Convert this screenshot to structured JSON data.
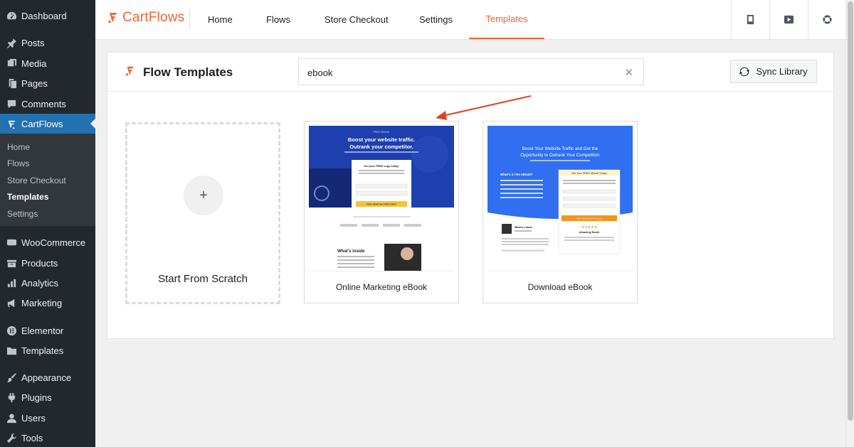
{
  "sidebar": {
    "dashboard": "Dashboard",
    "posts": "Posts",
    "media": "Media",
    "pages": "Pages",
    "comments": "Comments",
    "cartflows": "CartFlows",
    "submenu": [
      "Home",
      "Flows",
      "Store Checkout",
      "Templates",
      "Settings"
    ],
    "woocommerce": "WooCommerce",
    "products": "Products",
    "analytics": "Analytics",
    "marketing": "Marketing",
    "elementor": "Elementor",
    "templates": "Templates",
    "appearance": "Appearance",
    "plugins": "Plugins",
    "users": "Users",
    "tools": "Tools"
  },
  "topbar": {
    "brand": "CartFlows",
    "tabs": [
      "Home",
      "Flows",
      "Store Checkout",
      "Settings",
      "Templates"
    ],
    "active_tab": "Templates",
    "icons": [
      "book-icon",
      "youtube-icon",
      "support-icon"
    ]
  },
  "panel": {
    "title": "Flow Templates",
    "search_value": "ebook",
    "sync_label": "Sync Library",
    "scratch_label": "Start From Scratch",
    "templates": [
      {
        "label": "Online Marketing eBook",
        "thumb": {
          "badge": "FREE EBOOK",
          "headline_1": "Boost your website traffic.",
          "headline_2": "Outrank your competitor.",
          "form_title": "Get your FREE copy today!",
          "cta": "YES! I WANT MY FREE COPY!",
          "section": "What's inside"
        }
      },
      {
        "label": "Download eBook",
        "thumb": {
          "headline_1": "Boost Your Website Traffic and Get the",
          "headline_2": "Opportunity to Outrank Your Competition",
          "list_title": "What's in the eBook?",
          "form_title": "Get Your FREE eBook Today!",
          "cta": "Yes - Send My Free Copy",
          "review": "Amazing Book!",
          "author": "Martin Lukas"
        }
      }
    ]
  },
  "colors": {
    "accent": "#f06434",
    "wp_blue": "#2271b1",
    "sidebar_bg": "#23282d"
  }
}
